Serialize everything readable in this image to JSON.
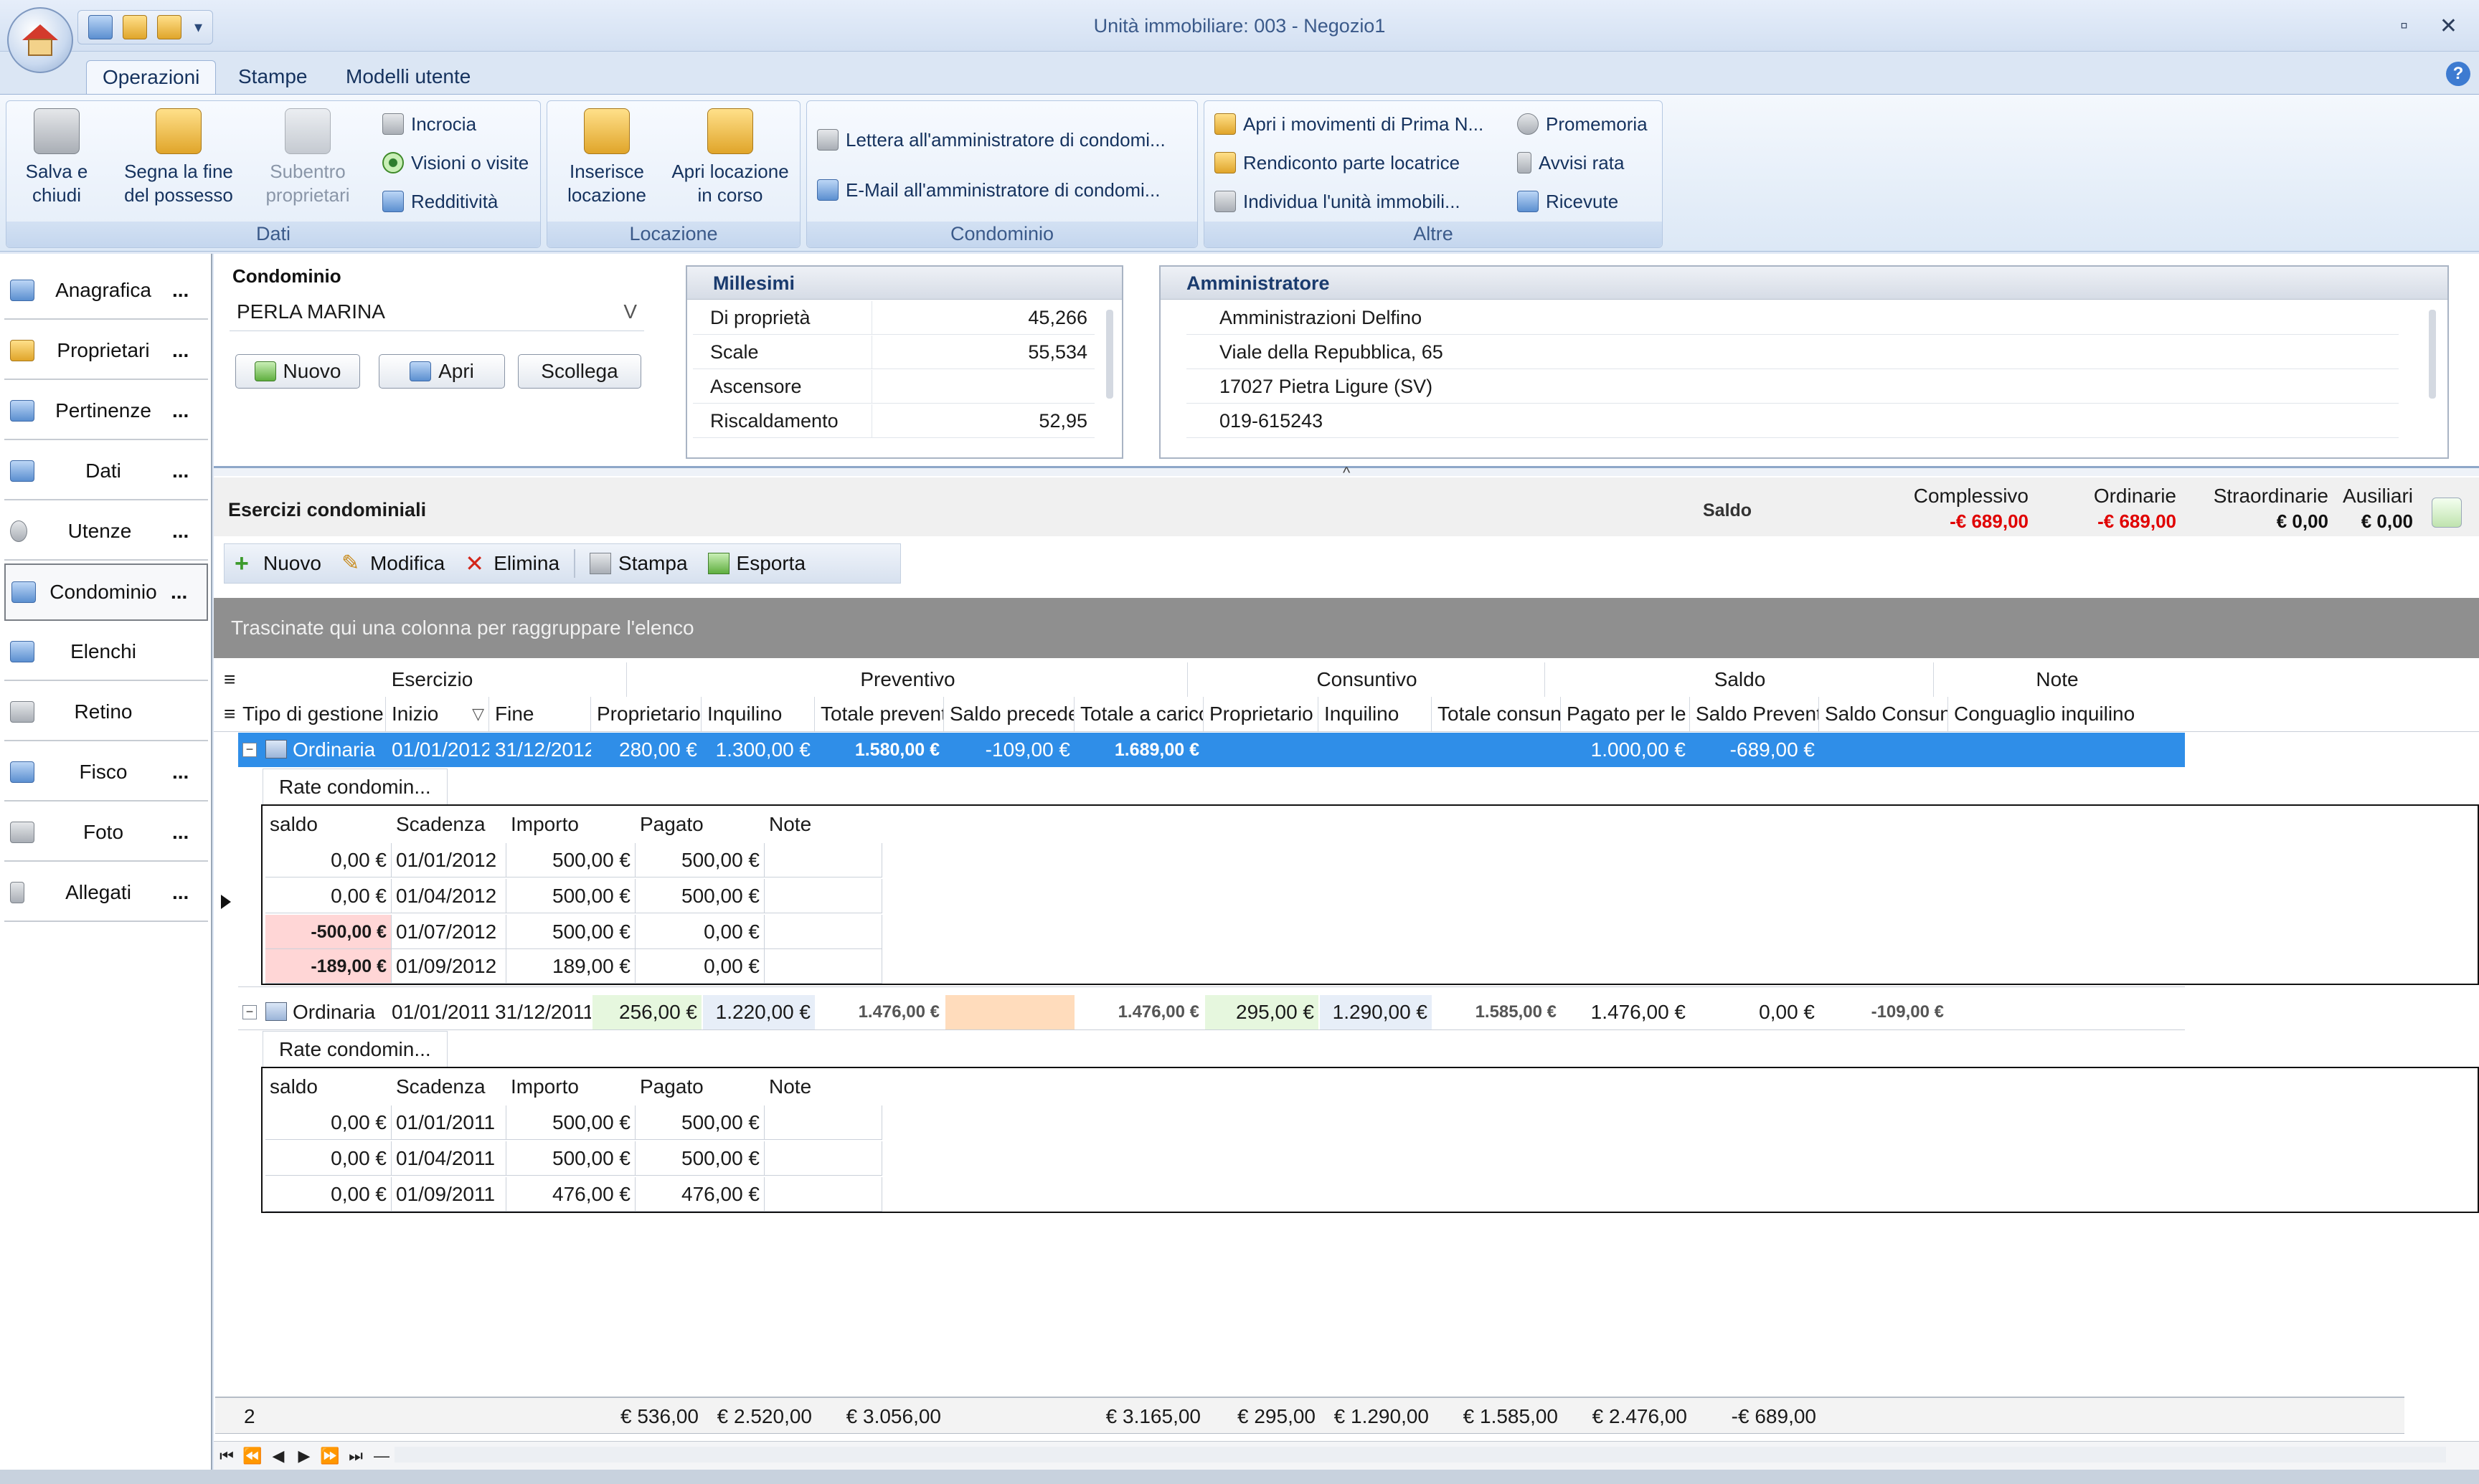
{
  "window": {
    "title": "Unità immobiliare: 003 - Negozio1",
    "minimize": "▫",
    "close": "✕"
  },
  "ribbon": {
    "tabs": [
      "Operazioni",
      "Stampe",
      "Modelli utente"
    ],
    "help": "?",
    "groups": {
      "dati": {
        "label": "Dati",
        "salva": "Salva e chiudi",
        "segna_l1": "Segna la fine",
        "segna_l2": "del possesso",
        "subentro_l1": "Subentro",
        "subentro_l2": "proprietari",
        "incrocia": "Incrocia",
        "visioni": "Visioni o visite",
        "redditivita": "Redditività"
      },
      "locazione": {
        "label": "Locazione",
        "inserisce_l1": "Inserisce",
        "inserisce_l2": "locazione",
        "apri_l1": "Apri locazione",
        "apri_l2": "in corso"
      },
      "condominio": {
        "label": "Condominio",
        "lettera": "Lettera all'amministratore di condomi...",
        "email": "E-Mail all'amministratore di condomi..."
      },
      "altre": {
        "label": "Altre",
        "movimenti": "Apri i movimenti di Prima N...",
        "rendiconto": "Rendiconto parte locatrice",
        "individua": "Individua l'unità immobili...",
        "promemoria": "Promemoria",
        "avvisi": "Avvisi rata",
        "ricevute": "Ricevute"
      }
    }
  },
  "sidebar": {
    "items": [
      {
        "label": "Anagrafica",
        "dots": "..."
      },
      {
        "label": "Proprietari",
        "dots": "..."
      },
      {
        "label": "Pertinenze",
        "dots": "..."
      },
      {
        "label": "Dati",
        "dots": "..."
      },
      {
        "label": "Utenze",
        "dots": "..."
      },
      {
        "label": "Condominio",
        "dots": "..."
      },
      {
        "label": "Elenchi",
        "dots": ""
      },
      {
        "label": "Retino",
        "dots": ""
      },
      {
        "label": "Fisco",
        "dots": "..."
      },
      {
        "label": "Foto",
        "dots": "..."
      },
      {
        "label": "Allegati",
        "dots": "..."
      }
    ]
  },
  "condominio": {
    "label": "Condominio",
    "value": "PERLA MARINA",
    "combo_arrow": "V",
    "nuovo": "Nuovo",
    "apri": "Apri",
    "scollega": "Scollega"
  },
  "millesimi": {
    "title": "Millesimi",
    "rows": [
      {
        "k": "Di proprietà",
        "v": "45,266"
      },
      {
        "k": "Scale",
        "v": "55,534"
      },
      {
        "k": "Ascensore",
        "v": ""
      },
      {
        "k": "Riscaldamento",
        "v": "52,95"
      }
    ]
  },
  "amministratore": {
    "title": "Amministratore",
    "lines": [
      "Amministrazioni Delfino",
      "Viale della Repubblica, 65",
      "17027 Pietra Ligure (SV)",
      "019-615243"
    ]
  },
  "splitter_grip": "^",
  "esercizi": {
    "title": "Esercizi condominiali",
    "saldo_label": "Saldo",
    "summary": [
      {
        "h": "Complessivo",
        "v": "-€ 689,00",
        "color": "#e00000"
      },
      {
        "h": "Ordinarie",
        "v": "-€ 689,00",
        "color": "#e00000"
      },
      {
        "h": "Straordinarie",
        "v": "€ 0,00",
        "color": "#111111"
      },
      {
        "h": "Ausiliari",
        "v": "€ 0,00",
        "color": "#111111"
      }
    ],
    "toolbar": {
      "nuovo": "Nuovo",
      "modifica": "Modifica",
      "elimina": "Elimina",
      "stampa": "Stampa",
      "esporta": "Esporta"
    },
    "group_hint": "Trascinate qui una colonna per raggruppare l'elenco"
  },
  "grid": {
    "bands": [
      "Esercizio",
      "Preventivo",
      "Consuntivo",
      "Saldo",
      "Note"
    ],
    "columns": [
      "Tipo di gestione",
      "Inizio",
      "Fine",
      "Proprietario",
      "Inquilino",
      "Totale preventivo",
      "Saldo precedente",
      "Totale a carico",
      "Proprietario",
      "Inquilino",
      "Totale consuntivo",
      "Pagato per le",
      "Saldo Preventivo",
      "Saldo Consuntivo",
      "Conguaglio inquilino"
    ],
    "sort_glyph": "▽",
    "rows": [
      {
        "tipo": "Ordinaria",
        "inizio": "01/01/2012",
        "fine": "31/12/2012",
        "prev_prop": "280,00 €",
        "prev_inq": "1.300,00 €",
        "tot_prev": "1.580,00 €",
        "saldo_prec": "-109,00 €",
        "tot_carico": "1.689,00 €",
        "cons_prop": "",
        "cons_inq": "",
        "tot_cons": "",
        "pagato": "1.000,00 €",
        "saldo_prev": "-689,00 €",
        "saldo_cons": "",
        "conguaglio": ""
      },
      {
        "tipo": "Ordinaria",
        "inizio": "01/01/2011",
        "fine": "31/12/2011",
        "prev_prop": "256,00 €",
        "prev_inq": "1.220,00 €",
        "tot_prev": "1.476,00 €",
        "saldo_prec": "",
        "tot_carico": "1.476,00 €",
        "cons_prop": "295,00 €",
        "cons_inq": "1.290,00 €",
        "tot_cons": "1.585,00 €",
        "pagato": "1.476,00 €",
        "saldo_prev": "0,00 €",
        "saldo_cons": "-109,00 €",
        "conguaglio": ""
      }
    ],
    "detail_tab": "Rate condomin...",
    "detail_columns": [
      "saldo",
      "Scadenza",
      "Importo",
      "Pagato",
      "Note"
    ],
    "detail1": [
      {
        "saldo": "0,00 €",
        "scad": "01/01/2012",
        "importo": "500,00 €",
        "pagato": "500,00 €"
      },
      {
        "saldo": "0,00 €",
        "scad": "01/04/2012",
        "importo": "500,00 €",
        "pagato": "500,00 €"
      },
      {
        "saldo": "-500,00 €",
        "scad": "01/07/2012",
        "importo": "500,00 €",
        "pagato": "0,00 €"
      },
      {
        "saldo": "-189,00 €",
        "scad": "01/09/2012",
        "importo": "189,00 €",
        "pagato": "0,00 €"
      }
    ],
    "detail2": [
      {
        "saldo": "0,00 €",
        "scad": "01/01/2011",
        "importo": "500,00 €",
        "pagato": "500,00 €"
      },
      {
        "saldo": "0,00 €",
        "scad": "01/04/2011",
        "importo": "500,00 €",
        "pagato": "500,00 €"
      },
      {
        "saldo": "0,00 €",
        "scad": "01/09/2011",
        "importo": "476,00 €",
        "pagato": "476,00 €"
      }
    ],
    "footer": {
      "count": "2",
      "prev_prop": "€ 536,00",
      "prev_inq": "€ 2.520,00",
      "tot_prev": "€ 3.056,00",
      "tot_carico": "€ 3.165,00",
      "cons_prop": "€ 295,00",
      "cons_inq": "€ 1.290,00",
      "tot_cons": "€ 1.585,00",
      "pagato": "€ 2.476,00",
      "saldo_prev": "-€ 689,00"
    },
    "nav": [
      "⏮",
      "⏪",
      "◀",
      "▶",
      "⏩",
      "⏭",
      "—",
      "✓",
      "✕",
      "✱",
      "✲"
    ]
  }
}
